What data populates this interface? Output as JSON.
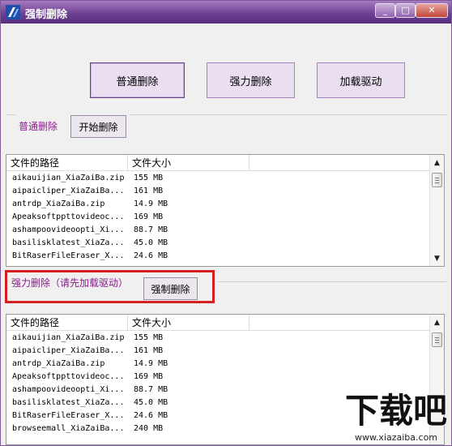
{
  "window": {
    "title": "强制删除",
    "controls": {
      "minimize": "_",
      "maximize": "□",
      "close": "✕"
    }
  },
  "modes": {
    "normal": "普通删除",
    "force": "强力删除",
    "load_driver": "加载驱动"
  },
  "normal_section": {
    "label": "普通删除",
    "start_button": "开始删除"
  },
  "force_section": {
    "label": "强力删除（请先加载驱动）",
    "delete_button": "强制删除"
  },
  "table": {
    "columns": {
      "path": "文件的路径",
      "size": "文件大小"
    },
    "rows1": [
      {
        "path": "aikauijian_XiaZaiBa.zip",
        "size": "155 MB"
      },
      {
        "path": "aipaicliper_XiaZaiBa...",
        "size": "161 MB"
      },
      {
        "path": "antrdp_XiaZaiBa.zip",
        "size": "14.9 MB"
      },
      {
        "path": "Apeaksoftppttovideoc...",
        "size": "169 MB"
      },
      {
        "path": "ashampoovideoopti_Xi...",
        "size": "88.7 MB"
      },
      {
        "path": "basilisklatest_XiaZa...",
        "size": "45.0 MB"
      },
      {
        "path": "BitRaserFileEraser_X...",
        "size": "24.6 MB"
      }
    ],
    "rows2": [
      {
        "path": "aikauijian_XiaZaiBa.zip",
        "size": "155 MB"
      },
      {
        "path": "aipaicliper_XiaZaiBa...",
        "size": "161 MB"
      },
      {
        "path": "antrdp_XiaZaiBa.zip",
        "size": "14.9 MB"
      },
      {
        "path": "Apeaksoftppttovideoc...",
        "size": "169 MB"
      },
      {
        "path": "ashampoovideoopti_Xi...",
        "size": "88.7 MB"
      },
      {
        "path": "basilisklatest_XiaZa...",
        "size": "45.0 MB"
      },
      {
        "path": "BitRaserFileEraser_X...",
        "size": "24.6 MB"
      },
      {
        "path": "browseemall_XiaZaiBa...",
        "size": "240 MB"
      }
    ]
  },
  "watermark": {
    "brand": "下载吧",
    "url": "www.xiazaiba.com"
  },
  "colors": {
    "accent": "#6b3d8f",
    "label": "#8b1a8b",
    "highlight": "#d42020"
  }
}
